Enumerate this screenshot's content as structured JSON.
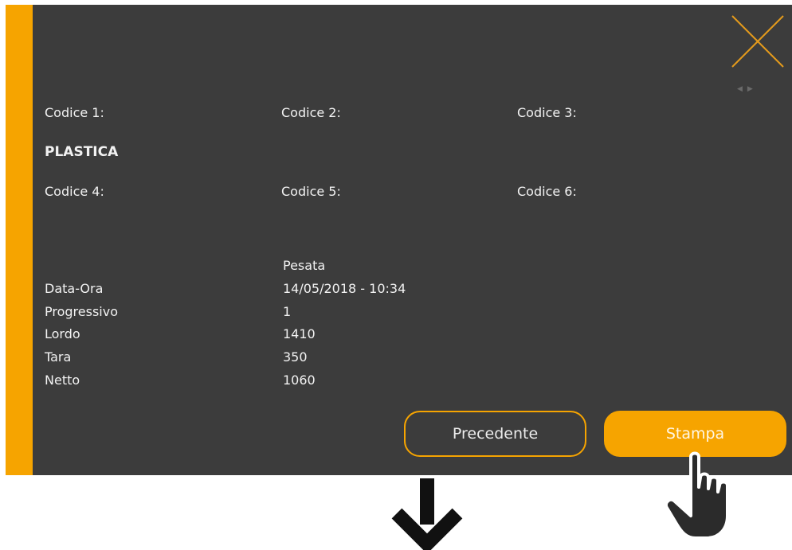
{
  "codes": {
    "codice1_label": "Codice 1:",
    "codice2_label": "Codice 2:",
    "codice3_label": "Codice 3:",
    "codice1_value": "PLASTICA",
    "codice4_label": "Codice 4:",
    "codice5_label": "Codice 5:",
    "codice6_label": "Codice 6:"
  },
  "weighing": {
    "column_header": "Pesata",
    "rows": [
      {
        "label": "Data-Ora",
        "value": "14/05/2018 - 10:34"
      },
      {
        "label": "Progressivo",
        "value": "1"
      },
      {
        "label": "Lordo",
        "value": "1410"
      },
      {
        "label": "Tara",
        "value": "350"
      },
      {
        "label": "Netto",
        "value": "1060"
      }
    ]
  },
  "buttons": {
    "previous_label": "Precedente",
    "print_label": "Stampa"
  },
  "icons": {
    "close": "close-icon",
    "pager": "pager-arrows-icon",
    "down_arrow": "down-arrow-icon",
    "pointer_hand": "pointer-hand-icon"
  },
  "colors": {
    "accent": "#f6a400",
    "panel_background": "#3c3c3c",
    "text": "#f2f2f2"
  }
}
